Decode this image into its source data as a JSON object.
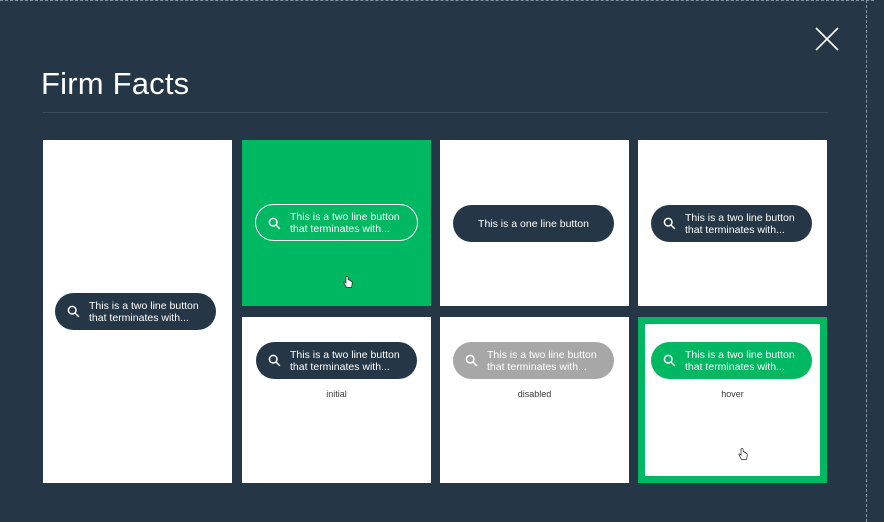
{
  "modal": {
    "title": "Firm Facts",
    "close_icon": "close-icon"
  },
  "colors": {
    "background": "#253646",
    "accent_green": "#00b862",
    "disabled_gray": "#a7a7a7",
    "tile_white": "#ffffff"
  },
  "tiles": {
    "tall": {
      "button_text": "This is a two line button that terminates with..."
    },
    "green": {
      "button_text": "This is a two line button that terminates with..."
    },
    "one_line": {
      "button_text": "This is a one line button"
    },
    "two_line": {
      "button_text": "This is a two line button that terminates with..."
    },
    "initial": {
      "button_text": "This is a two line button that terminates with...",
      "caption": "initial"
    },
    "disabled": {
      "button_text": "This is a two line button that terminates with...",
      "caption": "disabled"
    },
    "hover": {
      "button_text": "This is a two line button that terminates with...",
      "caption": "hover"
    }
  },
  "icons": {
    "button_icon": "search-icon",
    "pointer": "hand-pointer-icon"
  }
}
